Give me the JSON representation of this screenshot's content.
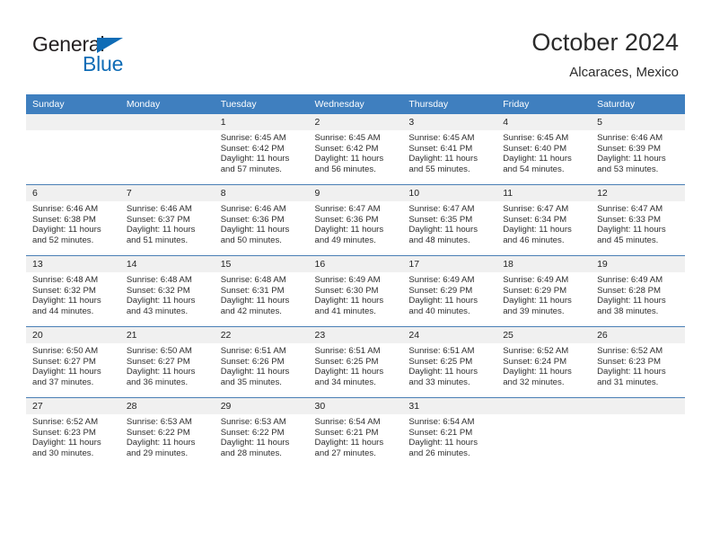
{
  "brand": {
    "name_part1": "General",
    "name_part2": "Blue",
    "triangle_color": "#0f6cb6"
  },
  "header": {
    "title": "October 2024",
    "subtitle": "Alcaraces, Mexico",
    "accent_color": "#3f7fbf"
  },
  "weekday_headers": [
    "Sunday",
    "Monday",
    "Tuesday",
    "Wednesday",
    "Thursday",
    "Friday",
    "Saturday"
  ],
  "labels": {
    "sunrise_prefix": "Sunrise:",
    "sunset_prefix": "Sunset:",
    "daylight_prefix": "Daylight:"
  },
  "weeks": [
    [
      {
        "day": "",
        "sunrise": "",
        "sunset": "",
        "daylight": ""
      },
      {
        "day": "",
        "sunrise": "",
        "sunset": "",
        "daylight": ""
      },
      {
        "day": "1",
        "sunrise": "Sunrise: 6:45 AM",
        "sunset": "Sunset: 6:42 PM",
        "daylight": "Daylight: 11 hours and 57 minutes."
      },
      {
        "day": "2",
        "sunrise": "Sunrise: 6:45 AM",
        "sunset": "Sunset: 6:42 PM",
        "daylight": "Daylight: 11 hours and 56 minutes."
      },
      {
        "day": "3",
        "sunrise": "Sunrise: 6:45 AM",
        "sunset": "Sunset: 6:41 PM",
        "daylight": "Daylight: 11 hours and 55 minutes."
      },
      {
        "day": "4",
        "sunrise": "Sunrise: 6:45 AM",
        "sunset": "Sunset: 6:40 PM",
        "daylight": "Daylight: 11 hours and 54 minutes."
      },
      {
        "day": "5",
        "sunrise": "Sunrise: 6:46 AM",
        "sunset": "Sunset: 6:39 PM",
        "daylight": "Daylight: 11 hours and 53 minutes."
      }
    ],
    [
      {
        "day": "6",
        "sunrise": "Sunrise: 6:46 AM",
        "sunset": "Sunset: 6:38 PM",
        "daylight": "Daylight: 11 hours and 52 minutes."
      },
      {
        "day": "7",
        "sunrise": "Sunrise: 6:46 AM",
        "sunset": "Sunset: 6:37 PM",
        "daylight": "Daylight: 11 hours and 51 minutes."
      },
      {
        "day": "8",
        "sunrise": "Sunrise: 6:46 AM",
        "sunset": "Sunset: 6:36 PM",
        "daylight": "Daylight: 11 hours and 50 minutes."
      },
      {
        "day": "9",
        "sunrise": "Sunrise: 6:47 AM",
        "sunset": "Sunset: 6:36 PM",
        "daylight": "Daylight: 11 hours and 49 minutes."
      },
      {
        "day": "10",
        "sunrise": "Sunrise: 6:47 AM",
        "sunset": "Sunset: 6:35 PM",
        "daylight": "Daylight: 11 hours and 48 minutes."
      },
      {
        "day": "11",
        "sunrise": "Sunrise: 6:47 AM",
        "sunset": "Sunset: 6:34 PM",
        "daylight": "Daylight: 11 hours and 46 minutes."
      },
      {
        "day": "12",
        "sunrise": "Sunrise: 6:47 AM",
        "sunset": "Sunset: 6:33 PM",
        "daylight": "Daylight: 11 hours and 45 minutes."
      }
    ],
    [
      {
        "day": "13",
        "sunrise": "Sunrise: 6:48 AM",
        "sunset": "Sunset: 6:32 PM",
        "daylight": "Daylight: 11 hours and 44 minutes."
      },
      {
        "day": "14",
        "sunrise": "Sunrise: 6:48 AM",
        "sunset": "Sunset: 6:32 PM",
        "daylight": "Daylight: 11 hours and 43 minutes."
      },
      {
        "day": "15",
        "sunrise": "Sunrise: 6:48 AM",
        "sunset": "Sunset: 6:31 PM",
        "daylight": "Daylight: 11 hours and 42 minutes."
      },
      {
        "day": "16",
        "sunrise": "Sunrise: 6:49 AM",
        "sunset": "Sunset: 6:30 PM",
        "daylight": "Daylight: 11 hours and 41 minutes."
      },
      {
        "day": "17",
        "sunrise": "Sunrise: 6:49 AM",
        "sunset": "Sunset: 6:29 PM",
        "daylight": "Daylight: 11 hours and 40 minutes."
      },
      {
        "day": "18",
        "sunrise": "Sunrise: 6:49 AM",
        "sunset": "Sunset: 6:29 PM",
        "daylight": "Daylight: 11 hours and 39 minutes."
      },
      {
        "day": "19",
        "sunrise": "Sunrise: 6:49 AM",
        "sunset": "Sunset: 6:28 PM",
        "daylight": "Daylight: 11 hours and 38 minutes."
      }
    ],
    [
      {
        "day": "20",
        "sunrise": "Sunrise: 6:50 AM",
        "sunset": "Sunset: 6:27 PM",
        "daylight": "Daylight: 11 hours and 37 minutes."
      },
      {
        "day": "21",
        "sunrise": "Sunrise: 6:50 AM",
        "sunset": "Sunset: 6:27 PM",
        "daylight": "Daylight: 11 hours and 36 minutes."
      },
      {
        "day": "22",
        "sunrise": "Sunrise: 6:51 AM",
        "sunset": "Sunset: 6:26 PM",
        "daylight": "Daylight: 11 hours and 35 minutes."
      },
      {
        "day": "23",
        "sunrise": "Sunrise: 6:51 AM",
        "sunset": "Sunset: 6:25 PM",
        "daylight": "Daylight: 11 hours and 34 minutes."
      },
      {
        "day": "24",
        "sunrise": "Sunrise: 6:51 AM",
        "sunset": "Sunset: 6:25 PM",
        "daylight": "Daylight: 11 hours and 33 minutes."
      },
      {
        "day": "25",
        "sunrise": "Sunrise: 6:52 AM",
        "sunset": "Sunset: 6:24 PM",
        "daylight": "Daylight: 11 hours and 32 minutes."
      },
      {
        "day": "26",
        "sunrise": "Sunrise: 6:52 AM",
        "sunset": "Sunset: 6:23 PM",
        "daylight": "Daylight: 11 hours and 31 minutes."
      }
    ],
    [
      {
        "day": "27",
        "sunrise": "Sunrise: 6:52 AM",
        "sunset": "Sunset: 6:23 PM",
        "daylight": "Daylight: 11 hours and 30 minutes."
      },
      {
        "day": "28",
        "sunrise": "Sunrise: 6:53 AM",
        "sunset": "Sunset: 6:22 PM",
        "daylight": "Daylight: 11 hours and 29 minutes."
      },
      {
        "day": "29",
        "sunrise": "Sunrise: 6:53 AM",
        "sunset": "Sunset: 6:22 PM",
        "daylight": "Daylight: 11 hours and 28 minutes."
      },
      {
        "day": "30",
        "sunrise": "Sunrise: 6:54 AM",
        "sunset": "Sunset: 6:21 PM",
        "daylight": "Daylight: 11 hours and 27 minutes."
      },
      {
        "day": "31",
        "sunrise": "Sunrise: 6:54 AM",
        "sunset": "Sunset: 6:21 PM",
        "daylight": "Daylight: 11 hours and 26 minutes."
      },
      {
        "day": "",
        "sunrise": "",
        "sunset": "",
        "daylight": ""
      },
      {
        "day": "",
        "sunrise": "",
        "sunset": "",
        "daylight": ""
      }
    ]
  ]
}
